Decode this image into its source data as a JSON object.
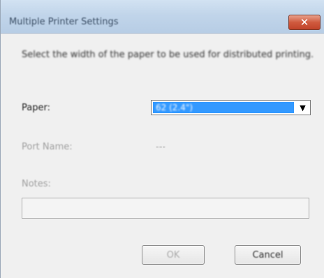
{
  "window": {
    "title": "Multiple Printer Settings",
    "close_glyph": "✕"
  },
  "description": "Select the width of the paper to be used for distributed printing.",
  "paper": {
    "label": "Paper:",
    "selected_value": "62 (2.4\")",
    "arrow_glyph": "▼"
  },
  "port_name": {
    "label": "Port Name:",
    "value": "---"
  },
  "notes": {
    "label": "Notes:",
    "value": ""
  },
  "buttons": {
    "ok_label": "OK",
    "cancel_label": "Cancel"
  },
  "colors": {
    "selection": "#3399ff",
    "close_button": "#c0432a",
    "dialog_background": "#f0f0f0"
  }
}
